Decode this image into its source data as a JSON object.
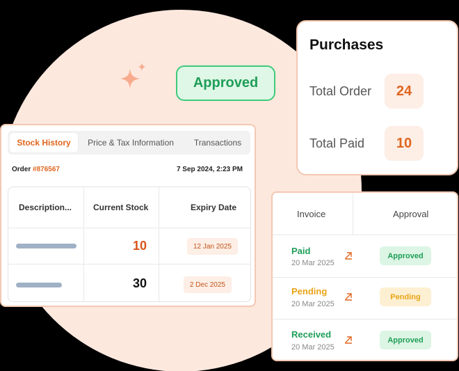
{
  "badge": {
    "label": "Approved"
  },
  "purchases": {
    "title": "Purchases",
    "stats": [
      {
        "label": "Total Order",
        "value": "24"
      },
      {
        "label": "Total Paid",
        "value": "10"
      }
    ]
  },
  "stock": {
    "tabs": [
      "Stock History",
      "Price & Tax Information",
      "Transactions"
    ],
    "active_tab": "Stock History",
    "order_label": "Order",
    "order_number": "#876567",
    "order_date": "7 Sep 2024, 2:23 PM",
    "columns": [
      "Description...",
      "Current Stock",
      "Expiry Date"
    ],
    "rows": [
      {
        "current_stock": "10",
        "expiry": "12 Jan 2025",
        "stock_color": "#d9541a"
      },
      {
        "current_stock": "30",
        "expiry": "2 Dec 2025",
        "stock_color": "#111111"
      }
    ]
  },
  "invoice": {
    "columns": [
      "Invoice",
      "Approval"
    ],
    "rows": [
      {
        "status": "Paid",
        "date": "20 Mar 2025",
        "approval": "Approved",
        "status_color": "#1f9e58"
      },
      {
        "status": "Pending",
        "date": "20 Mar 2025",
        "approval": "Pending",
        "status_color": "#e8a317"
      },
      {
        "status": "Received",
        "date": "20 Mar 2025",
        "approval": "Approved",
        "status_color": "#1f9e58"
      }
    ]
  },
  "colors": {
    "accent": "#e0661f",
    "approved_bg": "#dcf5e4",
    "approved_text": "#1f9e58",
    "pending_bg": "#fdf0d2",
    "pending_text": "#e8a317"
  }
}
